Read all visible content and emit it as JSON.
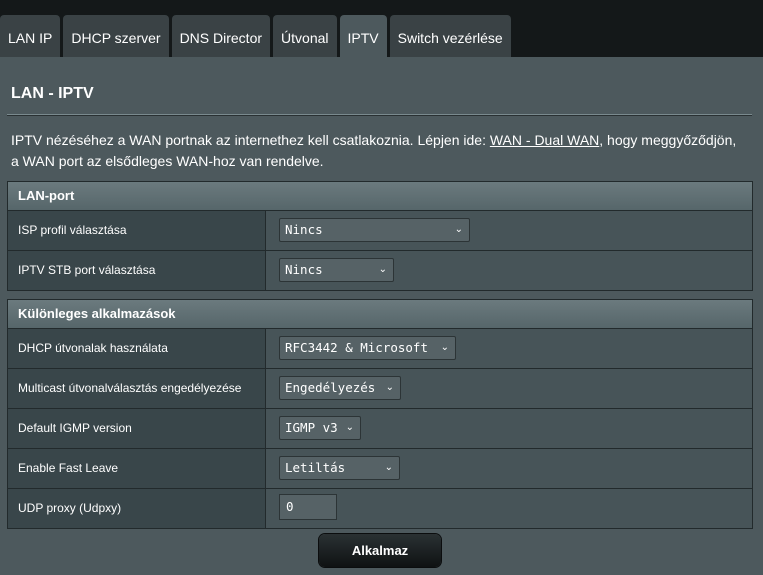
{
  "tabs": [
    {
      "label": "LAN IP"
    },
    {
      "label": "DHCP szerver"
    },
    {
      "label": "DNS Director"
    },
    {
      "label": "Útvonal"
    },
    {
      "label": "IPTV"
    },
    {
      "label": "Switch vezérlése"
    }
  ],
  "active_tab": "IPTV",
  "page": {
    "title": "LAN - IPTV",
    "desc_before": "IPTV nézéséhez a WAN portnak az internethez kell csatlakoznia. Lépjen ide: ",
    "desc_link": "WAN - Dual WAN",
    "desc_after": ", hogy meggyőződjön, a WAN port az elsődleges WAN-hoz van rendelve."
  },
  "lan_port": {
    "header": "LAN-port",
    "isp_profile_label": "ISP profil választása",
    "isp_profile_value": "Nincs",
    "stb_port_label": "IPTV STB port választása",
    "stb_port_value": "Nincs"
  },
  "special": {
    "header": "Különleges alkalmazások",
    "dhcp_routes_label": "DHCP útvonalak használata",
    "dhcp_routes_value": "RFC3442 & Microsoft",
    "multicast_label": "Multicast útvonalválasztás engedélyezése",
    "multicast_value": "Engedélyezés",
    "igmp_label": "Default IGMP version",
    "igmp_value": "IGMP v3",
    "fast_leave_label": "Enable Fast Leave",
    "fast_leave_value": "Letiltás",
    "udpxy_label": "UDP proxy (Udpxy)",
    "udpxy_value": "0"
  },
  "apply_label": "Alkalmaz",
  "colors": {
    "panel": "#4d595d",
    "tab": "#3a4245",
    "tab_active": "#4d595d",
    "label_cell": "#39464a",
    "value_cell": "#475458"
  }
}
